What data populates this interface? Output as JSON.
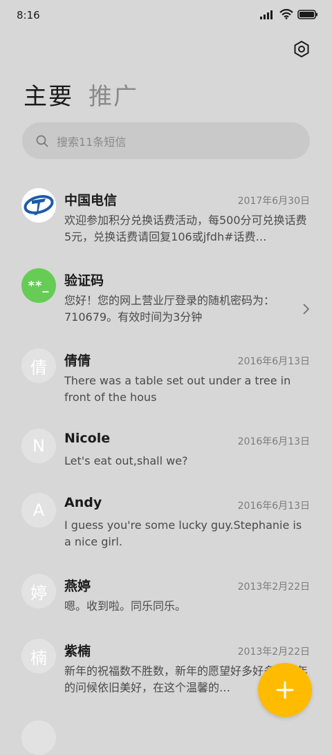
{
  "status_bar": {
    "time": "8:16"
  },
  "tabs": [
    {
      "label": "主要",
      "active": true
    },
    {
      "label": "推广",
      "active": false
    }
  ],
  "search": {
    "placeholder": "搜索11条短信"
  },
  "messages": [
    {
      "avatar": "",
      "avatar_type": "logo-telecom",
      "sender": "中国电信",
      "date": "2017年6月30日",
      "preview": "欢迎参加积分兑换话费活动，每500分可兑换话费5元，兑换话费请回复106或jfdh#话费…"
    },
    {
      "avatar": "**_",
      "avatar_type": "code",
      "sender": "验证码",
      "date": "",
      "preview": "您好！您的网上营业厅登录的随机密码为：710679。有效时间为3分钟"
    },
    {
      "avatar": "倩",
      "avatar_type": "letter",
      "sender": "倩倩",
      "date": "2016年6月13日",
      "preview": "There was a table set out under a tree in front of the hous"
    },
    {
      "avatar": "N",
      "avatar_type": "letter",
      "sender": "Nicole",
      "date": "2016年6月13日",
      "preview": "Let's eat out,shall we?"
    },
    {
      "avatar": "A",
      "avatar_type": "letter",
      "sender": "Andy",
      "date": "2016年6月13日",
      "preview": "I guess you're some lucky guy.Stephanie is a nice girl."
    },
    {
      "avatar": "婷",
      "avatar_type": "letter",
      "sender": "燕婷",
      "date": "2013年2月22日",
      "preview": "嗯。收到啦。同乐同乐。"
    },
    {
      "avatar": "楠",
      "avatar_type": "letter",
      "sender": "紫楠",
      "date": "2013年2月22日",
      "preview": "新年的祝福数不胜数，新年的愿望好多好多，新年的问候依旧美好，在这个温馨的…"
    }
  ],
  "colors": {
    "background": "#d7d7d7",
    "fab": "#ffbb00",
    "code_avatar": "#66cc55",
    "telecom_blue": "#1e5aa8"
  }
}
